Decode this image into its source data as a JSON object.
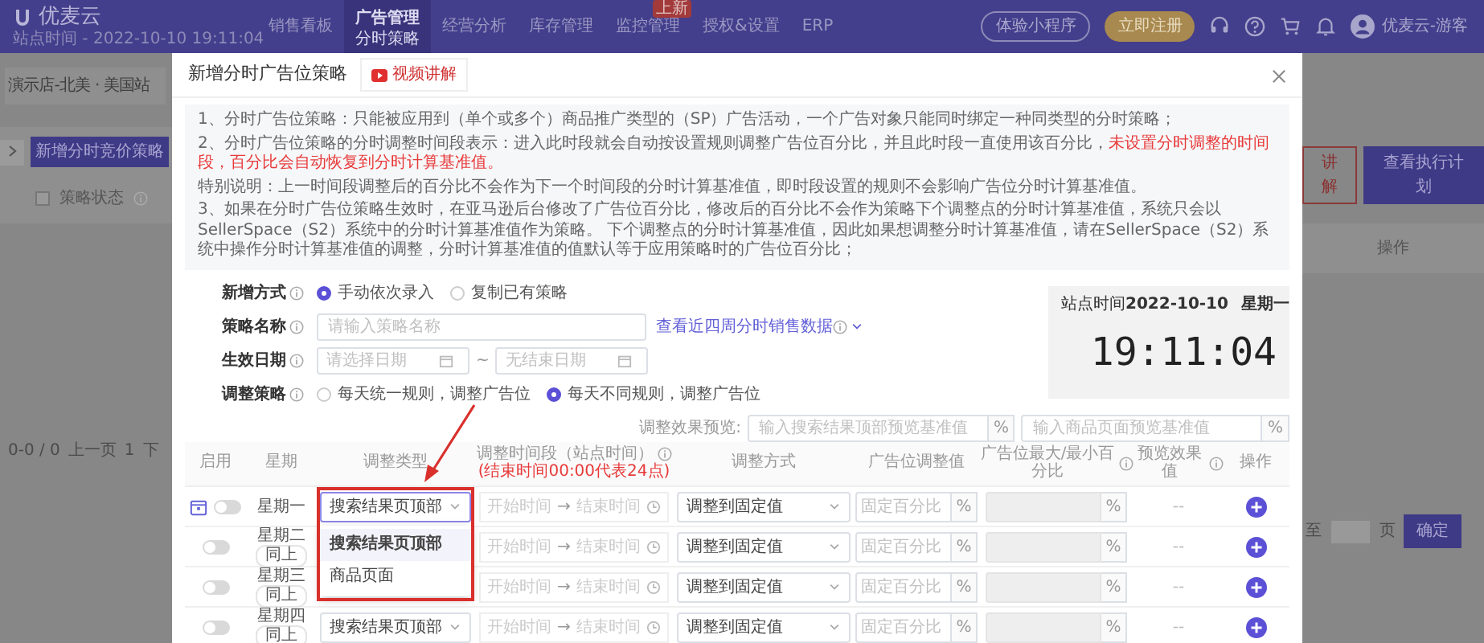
{
  "navbar": {
    "logo": "优麦云",
    "subtitle": "站点时间 - 2022-10-10 19:11:04",
    "items": [
      {
        "label": "销售看板",
        "selected": false
      },
      {
        "label": "广告管理",
        "sub": "分时策略",
        "selected": true
      },
      {
        "label": "经营分析",
        "selected": false
      },
      {
        "label": "库存管理",
        "selected": false
      },
      {
        "label": "监控管理",
        "badge": "上新",
        "selected": false
      },
      {
        "label": "授权&设置",
        "selected": false
      },
      {
        "label": "ERP",
        "selected": false
      }
    ],
    "mini_program_button": "体验小程序",
    "register_button": "立即注册",
    "user": "优麦云-游客"
  },
  "background_page": {
    "store": "演示店-北美 · 美国站",
    "add_button": "新增分时竞价策略",
    "select_all_checked": false,
    "status_column": "策略状态",
    "pagination": {
      "range": "0-0 / 0",
      "prev": "上一页",
      "page": "1",
      "next": "下"
    },
    "video_button": "讲解",
    "view_plan_button": "查看执行计划",
    "action_column": "操作",
    "goto": "至",
    "goto_unit": "页",
    "confirm": "确定"
  },
  "modal": {
    "title": "新增分时广告位策略",
    "video_button": "视频讲解",
    "notes": [
      {
        "parts": [
          {
            "kind": "plain",
            "text": "1、分时广告位策略：只能被应用到（单个或多个）商品推广类型的（SP）广告活动，一个广告对象只能同时绑定一种同类型的分时策略；"
          }
        ]
      },
      {
        "parts": [
          {
            "kind": "plain",
            "text": "2、分时广告位策略的分时调整时间段表示：进入此时段就会自动按设置规则调整广告位百分比，并且此时段一直使用该百分比，"
          },
          {
            "kind": "warning",
            "text": "未设置分时调整的时间段，百分比会自动恢复到分时计算基准值。"
          }
        ]
      },
      {
        "parts": [
          {
            "kind": "plain",
            "text": "特别说明：上一时间段调整后的百分比不会作为下一个时间段的分时计算基准值，即时段设置的规则不会影响广告位分时计算基准值。"
          }
        ]
      },
      {
        "parts": [
          {
            "kind": "plain",
            "text": "3、如果在分时广告位策略生效时，在亚马逊后台修改了广告位百分比，修改后的百分比不会作为策略下个调整点的分时计算基准值，系统只会以SellerSpace（S2）系统中的分时计算基准值作为策略。 下个调整点的分时计算基准值，因此如果想调整分时计算基准值，请在SellerSpace（S2）系统中操作分时计算基准值的调整，分时计算基准值的值默认等于应用策略时的广告位百分比；"
          }
        ]
      }
    ],
    "fields": [
      {
        "label": "新增方式",
        "kind": "radio",
        "options": [
          {
            "label": "手动依次录入",
            "selected": true
          },
          {
            "label": "复制已有策略",
            "selected": false
          }
        ]
      },
      {
        "label": "策略名称",
        "kind": "text",
        "placeholder": "请输入策略名称",
        "link": "查看近四周分时销售数据"
      },
      {
        "label": "生效日期",
        "kind": "daterange",
        "start_placeholder": "请选择日期",
        "separator": "~",
        "end_placeholder": "无结束日期"
      },
      {
        "label": "调整策略",
        "kind": "radio",
        "options": [
          {
            "label": "每天统一规则，调整广告位",
            "selected": false
          },
          {
            "label": "每天不同规则，调整广告位",
            "selected": true
          }
        ]
      }
    ],
    "clock": {
      "label": "站点时间",
      "date": "2022-10-10",
      "weekday": "星期一",
      "time": "19:11:04"
    },
    "preview": {
      "label": "调整效果预览:",
      "search_placeholder": "输入搜索结果顶部预览基准值",
      "search_unit": "%",
      "product_placeholder": "输入商品页面预览基准值",
      "product_unit": "%"
    },
    "table": {
      "columns": [
        {
          "label": "启用"
        },
        {
          "label": "星期"
        },
        {
          "label": "调整类型"
        },
        {
          "label": "调整时间段（站点时间）",
          "note": "(结束时间00:00代表24点)",
          "info": true
        },
        {
          "label": "调整方式"
        },
        {
          "label": "广告位调整值"
        },
        {
          "label": "广告位最大/最小百分比",
          "info": true
        },
        {
          "label": "预览效果值",
          "info": true
        },
        {
          "label": "操作"
        }
      ],
      "rows": [
        {
          "kind": "first",
          "on": false,
          "day": "星期一",
          "type": "搜索结果页顶部",
          "focused": true,
          "start_placeholder": "开始时间",
          "arrow": "→",
          "end_placeholder": "结束时间",
          "method": "调整到固定值",
          "value_placeholder": "固定百分比",
          "value_unit": "%",
          "range_unit": "%",
          "preview": "--"
        },
        {
          "kind": "repeat",
          "on": false,
          "day": "星期二",
          "same_button": "同上",
          "start_placeholder": "开始时间",
          "arrow": "→",
          "end_placeholder": "结束时间",
          "method": "调整到固定值",
          "value_placeholder": "固定百分比",
          "value_unit": "%",
          "range_unit": "%",
          "preview": "--"
        },
        {
          "kind": "repeat",
          "on": false,
          "day": "星期三",
          "same_button": "同上",
          "start_placeholder": "开始时间",
          "arrow": "→",
          "end_placeholder": "结束时间",
          "method": "调整到固定值",
          "value_placeholder": "固定百分比",
          "value_unit": "%",
          "range_unit": "%",
          "preview": "--"
        },
        {
          "kind": "repeat",
          "on": false,
          "day": "星期四",
          "same_button": "同上",
          "type": "搜索结果页顶部",
          "focused": false,
          "start_placeholder": "开始时间",
          "arrow": "→",
          "end_placeholder": "结束时间",
          "method": "调整到固定值",
          "value_placeholder": "固定百分比",
          "value_unit": "%",
          "range_unit": "%",
          "preview": "--"
        }
      ],
      "dropdown": {
        "options": [
          {
            "label": "搜索结果页顶部",
            "selected": true
          },
          {
            "label": "商品页面",
            "selected": false
          }
        ]
      }
    }
  }
}
